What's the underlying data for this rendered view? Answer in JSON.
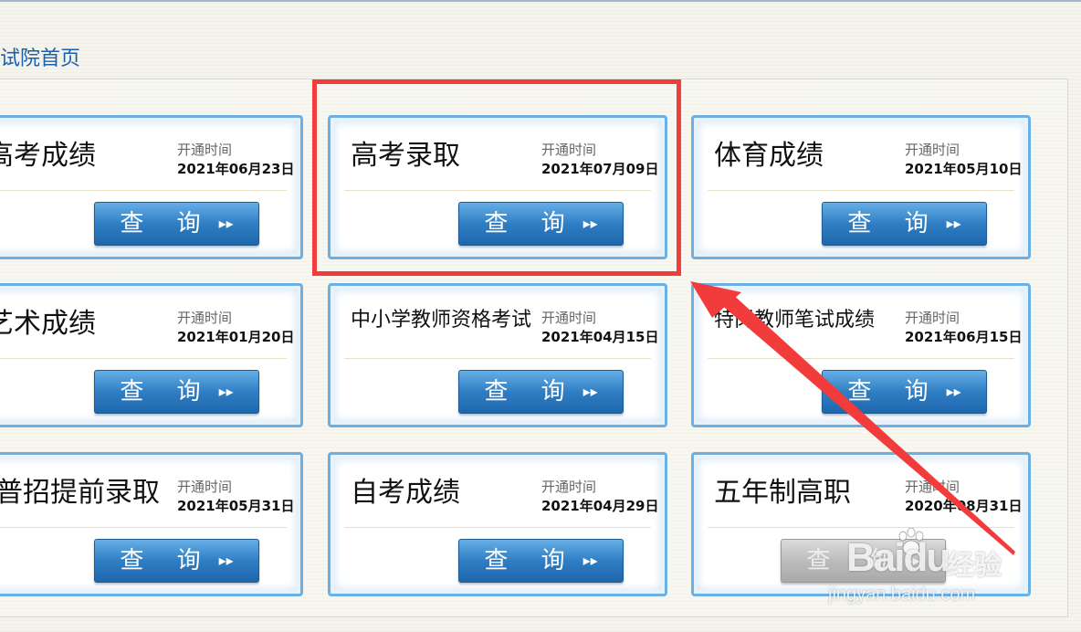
{
  "breadcrumb": {
    "text": "试院首页"
  },
  "open_label": "开通时间",
  "button": {
    "label": "查 询",
    "arrow": "▸▸"
  },
  "cards": [
    {
      "title": "高考成绩",
      "date": "2021年06月23日",
      "enabled": true
    },
    {
      "title": "高考录取",
      "date": "2021年07月09日",
      "enabled": true,
      "highlighted": true
    },
    {
      "title": "体育成绩",
      "date": "2021年05月10日",
      "enabled": true
    },
    {
      "title": "艺术成绩",
      "date": "2021年01月20日",
      "enabled": true
    },
    {
      "title": "中小学教师资格考试",
      "date": "2021年04月15日",
      "enabled": true
    },
    {
      "title": "特岗教师笔试成绩",
      "date": "2021年06月15日",
      "enabled": true
    },
    {
      "title": "普招提前录取",
      "date": "2021年05月31日",
      "enabled": true
    },
    {
      "title": "自考成绩",
      "date": "2021年04月29日",
      "enabled": true
    },
    {
      "title": "五年制高职",
      "date": "2020年08月31日",
      "enabled": false
    }
  ],
  "watermark": {
    "logo": "Baidu",
    "logo_suffix": "经验",
    "url": "jingyan.baidu.com"
  },
  "colors": {
    "accent": "#2f7ec4",
    "card_border": "#6ab0e4",
    "annotation": "#f23c3c",
    "link": "#1a5fb0"
  }
}
